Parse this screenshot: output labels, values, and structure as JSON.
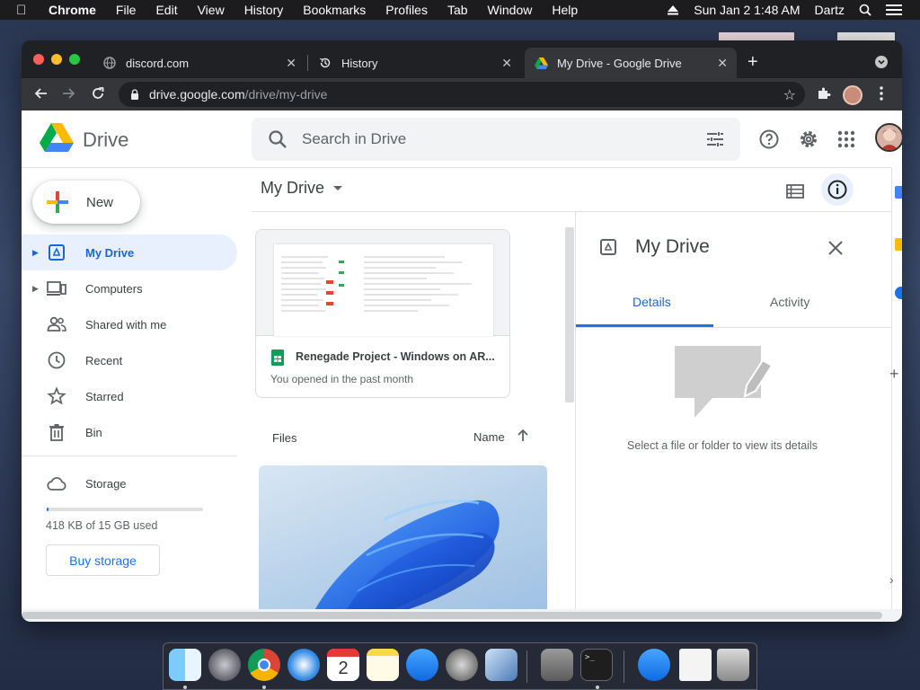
{
  "menubar": {
    "app": "Chrome",
    "items": [
      "File",
      "Edit",
      "View",
      "History",
      "Bookmarks",
      "Profiles",
      "Tab",
      "Window",
      "Help"
    ],
    "clock": "Sun Jan 2  1:48 AM",
    "user": "Dartz"
  },
  "browser": {
    "tabs": [
      {
        "title": "discord.com",
        "icon": "globe-icon"
      },
      {
        "title": "History",
        "icon": "history-icon"
      },
      {
        "title": "My Drive - Google Drive",
        "icon": "drive-icon",
        "active": true
      }
    ],
    "url_host": "drive.google.com",
    "url_path": "/drive/my-drive"
  },
  "drive": {
    "app_name": "Drive",
    "search_placeholder": "Search in Drive",
    "new_label": "New",
    "nav": [
      {
        "label": "My Drive",
        "icon": "my-drive-icon",
        "active": true,
        "expandable": true
      },
      {
        "label": "Computers",
        "icon": "computers-icon",
        "expandable": true
      },
      {
        "label": "Shared with me",
        "icon": "shared-icon"
      },
      {
        "label": "Recent",
        "icon": "clock-icon"
      },
      {
        "label": "Starred",
        "icon": "star-icon"
      },
      {
        "label": "Bin",
        "icon": "trash-icon"
      }
    ],
    "storage_label": "Storage",
    "storage_used": "418 KB of 15 GB used",
    "storage_fraction": 3e-05,
    "buy_storage": "Buy storage",
    "main_title": "My Drive",
    "quick_access": {
      "name": "Renegade Project - Windows on AR...",
      "subtitle": "You opened in the past month"
    },
    "files_label": "Files",
    "sort_label": "Name",
    "details_panel": {
      "title": "My Drive",
      "tabs": [
        "Details",
        "Activity"
      ],
      "empty_text": "Select a file or folder to view its details"
    }
  },
  "colors": {
    "accent": "#1a73e8",
    "active_nav_bg": "#e8f0fe",
    "chrome_dark": "#202124"
  }
}
